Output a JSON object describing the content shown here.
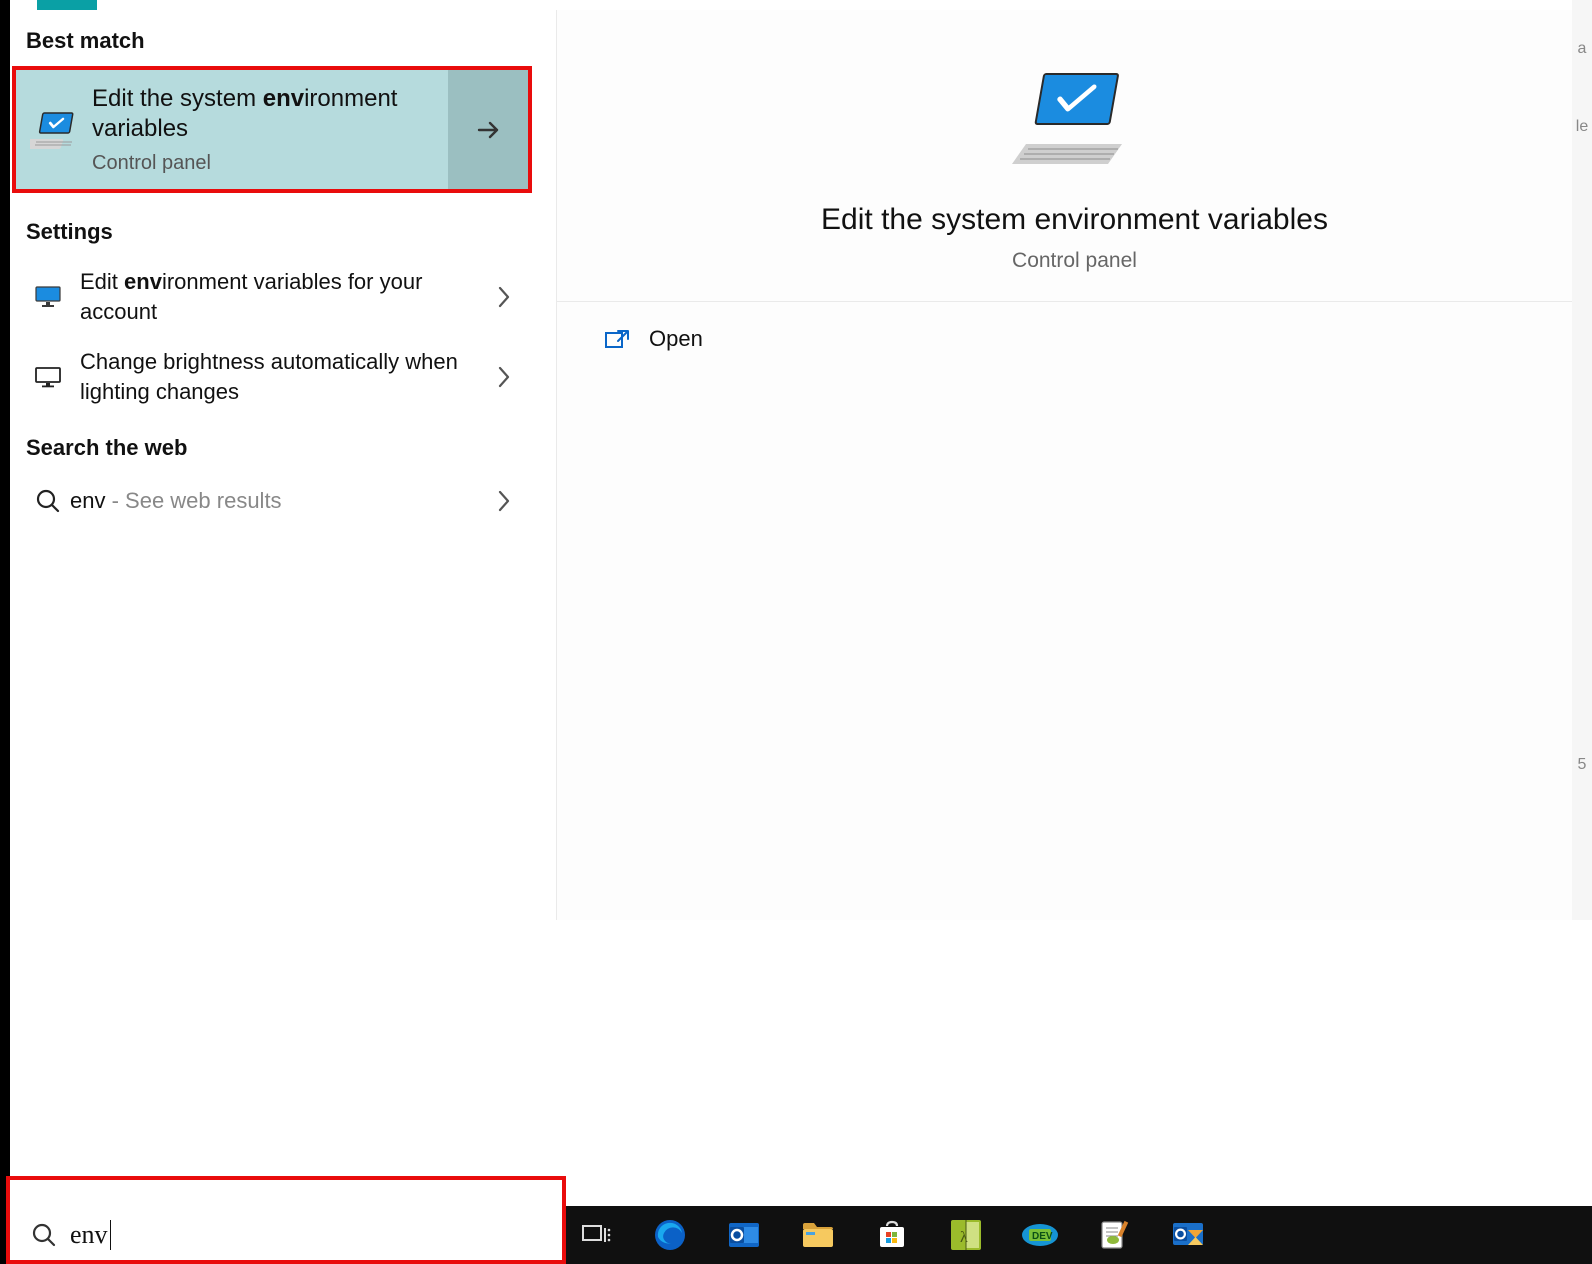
{
  "sections": {
    "best_match": "Best match",
    "settings": "Settings",
    "search_web": "Search the web"
  },
  "best_match_item": {
    "title_pre": "Edit the system ",
    "title_bold": "env",
    "title_post": "ironment variables",
    "subtitle": "Control panel"
  },
  "settings_items": [
    {
      "title_pre": "Edit ",
      "title_bold": "env",
      "title_post": "ironment variables for your account"
    },
    {
      "title_pre": "Change brightness automatically when lighting changes",
      "title_bold": "",
      "title_post": ""
    }
  ],
  "web_item": {
    "query": "env",
    "suffix": " - See web results"
  },
  "preview": {
    "title": "Edit the system environment variables",
    "subtitle": "Control panel",
    "open_label": "Open"
  },
  "search": {
    "typed": "env"
  },
  "far_right_glyphs": [
    "a",
    "le",
    "5"
  ]
}
